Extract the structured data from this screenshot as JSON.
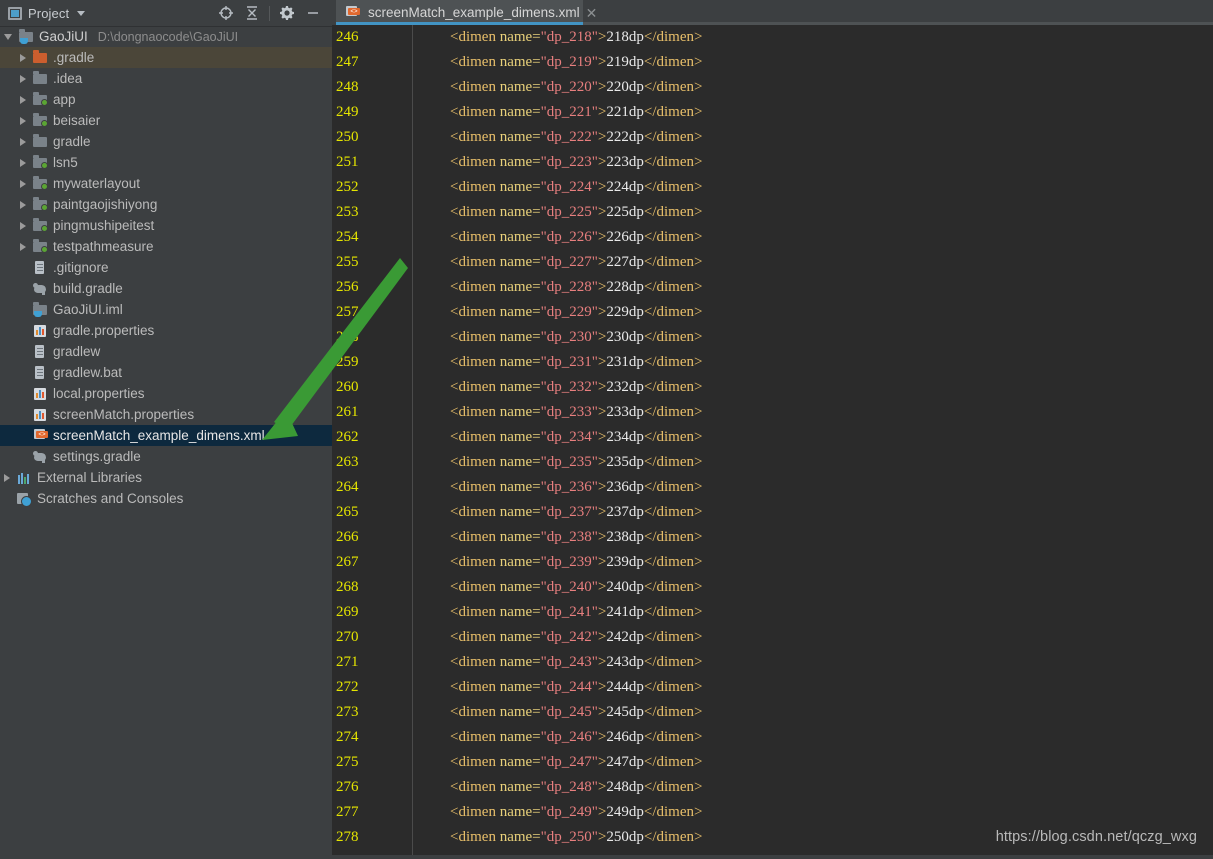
{
  "tool_window": {
    "title": "Project",
    "title_icon": "project-panel-icon",
    "dropdown_icon": "chevron-down-icon",
    "actions": [
      {
        "name": "locate-icon",
        "glyph": "target"
      },
      {
        "name": "collapse-all-icon",
        "glyph": "collapse"
      },
      {
        "name": "settings-gear-icon",
        "glyph": "gear"
      },
      {
        "name": "hide-minimize-icon",
        "glyph": "minus"
      }
    ]
  },
  "tree": {
    "root": {
      "label": "GaoJiUI",
      "path": "D:\\dongnaocode\\GaoJiUI",
      "icon": "project-root-icon",
      "expanded": true
    },
    "items": [
      {
        "label": ".gradle",
        "icon": "folder-orange-icon",
        "indent": 1,
        "arrow": "right",
        "state": "hover"
      },
      {
        "label": ".idea",
        "icon": "folder-icon",
        "indent": 1,
        "arrow": "right",
        "state": "normal"
      },
      {
        "label": "app",
        "icon": "module-icon",
        "indent": 1,
        "arrow": "right",
        "state": "normal"
      },
      {
        "label": "beisaier",
        "icon": "module-icon",
        "indent": 1,
        "arrow": "right",
        "state": "normal"
      },
      {
        "label": "gradle",
        "icon": "folder-icon",
        "indent": 1,
        "arrow": "right",
        "state": "normal"
      },
      {
        "label": "lsn5",
        "icon": "module-icon",
        "indent": 1,
        "arrow": "right",
        "state": "normal"
      },
      {
        "label": "mywaterlayout",
        "icon": "module-icon",
        "indent": 1,
        "arrow": "right",
        "state": "normal"
      },
      {
        "label": "paintgaojishiyong",
        "icon": "module-icon",
        "indent": 1,
        "arrow": "right",
        "state": "normal"
      },
      {
        "label": "pingmushipeitest",
        "icon": "module-icon",
        "indent": 1,
        "arrow": "right",
        "state": "normal"
      },
      {
        "label": "testpathmeasure",
        "icon": "module-icon",
        "indent": 1,
        "arrow": "right",
        "state": "normal"
      },
      {
        "label": ".gitignore",
        "icon": "file-icon",
        "indent": 1,
        "arrow": "none",
        "state": "normal"
      },
      {
        "label": "build.gradle",
        "icon": "gradle-icon",
        "indent": 1,
        "arrow": "none",
        "state": "normal"
      },
      {
        "label": "GaoJiUI.iml",
        "icon": "iml-icon",
        "indent": 1,
        "arrow": "none",
        "state": "normal"
      },
      {
        "label": "gradle.properties",
        "icon": "properties-icon",
        "indent": 1,
        "arrow": "none",
        "state": "normal"
      },
      {
        "label": "gradlew",
        "icon": "file-icon",
        "indent": 1,
        "arrow": "none",
        "state": "normal"
      },
      {
        "label": "gradlew.bat",
        "icon": "file-icon",
        "indent": 1,
        "arrow": "none",
        "state": "normal"
      },
      {
        "label": "local.properties",
        "icon": "properties-icon",
        "indent": 1,
        "arrow": "none",
        "state": "normal"
      },
      {
        "label": "screenMatch.properties",
        "icon": "properties-icon",
        "indent": 1,
        "arrow": "none",
        "state": "normal"
      },
      {
        "label": "screenMatch_example_dimens.xml",
        "icon": "xml-icon",
        "indent": 1,
        "arrow": "none",
        "state": "selected"
      },
      {
        "label": "settings.gradle",
        "icon": "gradle-icon",
        "indent": 1,
        "arrow": "none",
        "state": "normal"
      },
      {
        "label": "External Libraries",
        "icon": "external-libraries-icon",
        "indent": 0,
        "arrow": "right",
        "state": "normal"
      },
      {
        "label": "Scratches and Consoles",
        "icon": "scratches-icon",
        "indent": 0,
        "arrow": "none",
        "state": "normal"
      }
    ]
  },
  "editor": {
    "tab": {
      "label": "screenMatch_example_dimens.xml",
      "icon": "xml-file-icon",
      "close_label": "✕",
      "active": true
    },
    "first_line_number": 246,
    "last_line_number": 278,
    "line_prefix": "        <dimen name=\"",
    "lines": [
      {
        "num": 246,
        "name": "dp_218",
        "value": "218dp"
      },
      {
        "num": 247,
        "name": "dp_219",
        "value": "219dp"
      },
      {
        "num": 248,
        "name": "dp_220",
        "value": "220dp"
      },
      {
        "num": 249,
        "name": "dp_221",
        "value": "221dp"
      },
      {
        "num": 250,
        "name": "dp_222",
        "value": "222dp"
      },
      {
        "num": 251,
        "name": "dp_223",
        "value": "223dp"
      },
      {
        "num": 252,
        "name": "dp_224",
        "value": "224dp"
      },
      {
        "num": 253,
        "name": "dp_225",
        "value": "225dp"
      },
      {
        "num": 254,
        "name": "dp_226",
        "value": "226dp"
      },
      {
        "num": 255,
        "name": "dp_227",
        "value": "227dp"
      },
      {
        "num": 256,
        "name": "dp_228",
        "value": "228dp"
      },
      {
        "num": 257,
        "name": "dp_229",
        "value": "229dp"
      },
      {
        "num": 258,
        "name": "dp_230",
        "value": "230dp"
      },
      {
        "num": 259,
        "name": "dp_231",
        "value": "231dp"
      },
      {
        "num": 260,
        "name": "dp_232",
        "value": "232dp"
      },
      {
        "num": 261,
        "name": "dp_233",
        "value": "233dp"
      },
      {
        "num": 262,
        "name": "dp_234",
        "value": "234dp"
      },
      {
        "num": 263,
        "name": "dp_235",
        "value": "235dp"
      },
      {
        "num": 264,
        "name": "dp_236",
        "value": "236dp"
      },
      {
        "num": 265,
        "name": "dp_237",
        "value": "237dp"
      },
      {
        "num": 266,
        "name": "dp_238",
        "value": "238dp"
      },
      {
        "num": 267,
        "name": "dp_239",
        "value": "239dp"
      },
      {
        "num": 268,
        "name": "dp_240",
        "value": "240dp"
      },
      {
        "num": 269,
        "name": "dp_241",
        "value": "241dp"
      },
      {
        "num": 270,
        "name": "dp_242",
        "value": "242dp"
      },
      {
        "num": 271,
        "name": "dp_243",
        "value": "243dp"
      },
      {
        "num": 272,
        "name": "dp_244",
        "value": "244dp"
      },
      {
        "num": 273,
        "name": "dp_245",
        "value": "245dp"
      },
      {
        "num": 274,
        "name": "dp_246",
        "value": "246dp"
      },
      {
        "num": 275,
        "name": "dp_247",
        "value": "247dp"
      },
      {
        "num": 276,
        "name": "dp_248",
        "value": "248dp"
      },
      {
        "num": 277,
        "name": "dp_249",
        "value": "249dp"
      },
      {
        "num": 278,
        "name": "dp_250",
        "value": "250dp"
      }
    ]
  },
  "annotation": {
    "arrow_color": "#3a9a35",
    "arrow_name": "green-pointer-arrow"
  },
  "watermark": {
    "text": "https://blog.csdn.net/qczg_wxg"
  },
  "colors": {
    "panel_bg": "#3c3f41",
    "editor_bg": "#2b2b2b",
    "selection_bg": "#0d293e",
    "hover_bg": "#4b4639",
    "line_number": "#e5e500",
    "tag": "#e8bf6a",
    "attr_value": "#e87f7f",
    "text": "#e9e9e9",
    "tab_underline": "#4294c4"
  }
}
